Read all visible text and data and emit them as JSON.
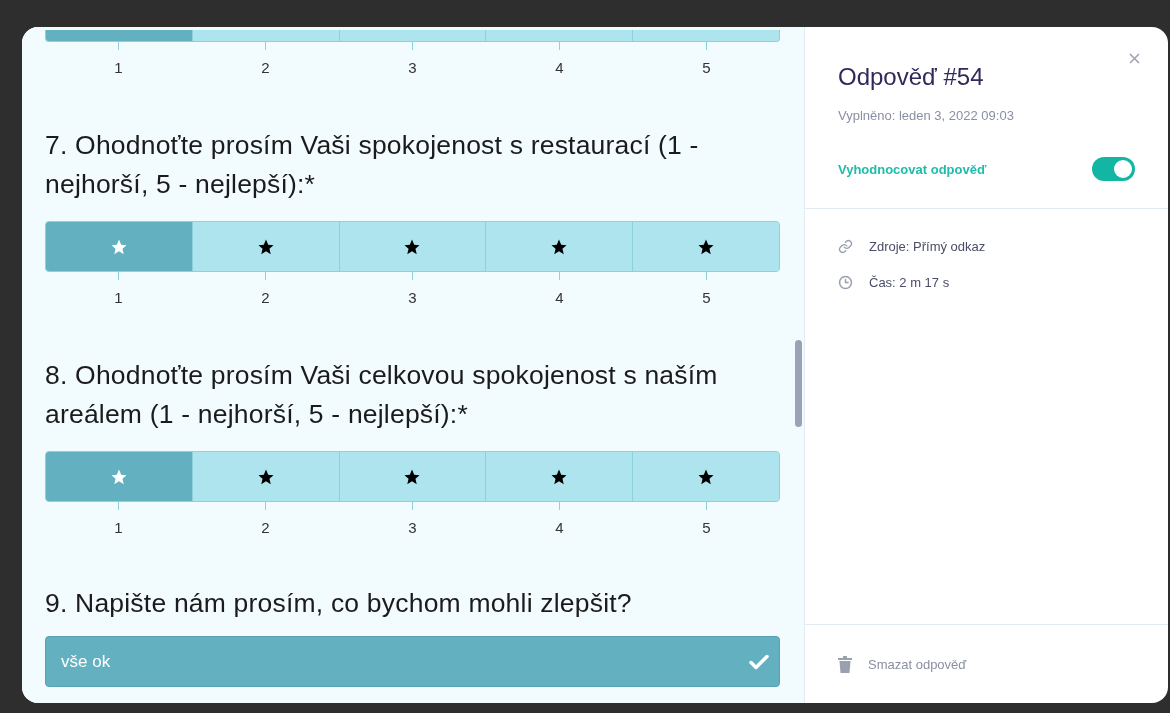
{
  "questions": [
    {
      "kind": "rating",
      "options": [
        {
          "label": "1",
          "selected": true
        },
        {
          "label": "2",
          "selected": false
        },
        {
          "label": "3",
          "selected": false
        },
        {
          "label": "4",
          "selected": false
        },
        {
          "label": "5",
          "selected": false
        }
      ]
    },
    {
      "kind": "rating",
      "title": "7. Ohodnoťte prosím Vaši spokojenost s restaurací (1 - nejhorší, 5 - nejlepší):*",
      "options": [
        {
          "label": "1",
          "selected": true
        },
        {
          "label": "2",
          "selected": false
        },
        {
          "label": "3",
          "selected": false
        },
        {
          "label": "4",
          "selected": false
        },
        {
          "label": "5",
          "selected": false
        }
      ]
    },
    {
      "kind": "rating",
      "title": "8. Ohodnoťte prosím Vaši celkovou spokojenost s naším areálem (1 - nejhorší, 5 - nejlepší):*",
      "options": [
        {
          "label": "1",
          "selected": true
        },
        {
          "label": "2",
          "selected": false
        },
        {
          "label": "3",
          "selected": false
        },
        {
          "label": "4",
          "selected": false
        },
        {
          "label": "5",
          "selected": false
        }
      ]
    },
    {
      "kind": "text",
      "title": "9. Napište nám prosím, co bychom mohli zlepšit?",
      "value": "vše ok",
      "checked": true
    }
  ],
  "panel": {
    "title": "Odpověď #54",
    "filled": "Vyplněno: leden 3, 2022 09:03",
    "toggle": {
      "label": "Vyhodnocovat odpověď",
      "on": true
    },
    "info": [
      {
        "kind": "link",
        "text": "Zdroje: Přímý odkaz"
      },
      {
        "kind": "time",
        "text": "Čas: 2 m 17 s"
      }
    ],
    "delete": "Smazat odpověď"
  }
}
